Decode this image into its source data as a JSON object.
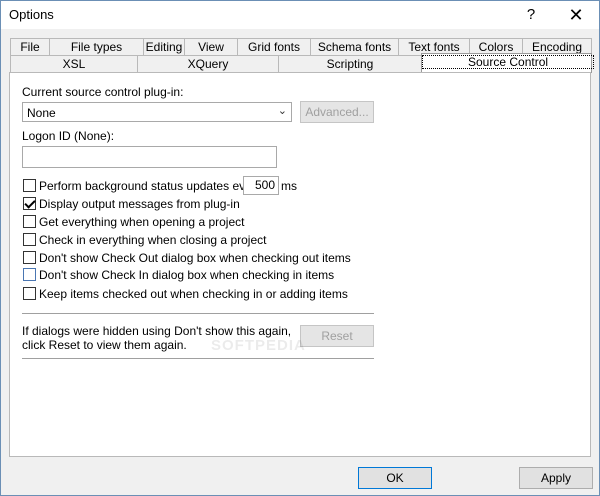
{
  "window": {
    "title": "Options",
    "help_glyph": "?",
    "close_glyph": "✕"
  },
  "tabs_row1": [
    "File",
    "File types",
    "Editing",
    "View",
    "Grid fonts",
    "Schema fonts",
    "Text fonts",
    "Colors",
    "Encoding"
  ],
  "tabs_row2": [
    "XSL",
    "XQuery",
    "Scripting",
    "Source Control"
  ],
  "active_tab": "Source Control",
  "source_control": {
    "plugin_label": "Current source control plug-in:",
    "plugin_value": "None",
    "advanced_button": "Advanced...",
    "logon_label": "Logon ID (None):",
    "logon_value": "",
    "bg_update_label": "Perform background status updates every",
    "bg_update_value": "500",
    "bg_update_unit": "ms",
    "options": [
      {
        "label": "Display output messages from plug-in",
        "checked": true
      },
      {
        "label": "Get everything when opening a project",
        "checked": false
      },
      {
        "label": "Check in everything when closing a project",
        "checked": false
      },
      {
        "label": "Don't show Check Out dialog box when checking out items",
        "checked": false
      },
      {
        "label": "Don't show Check In dialog box when checking in items",
        "checked": false
      },
      {
        "label": "Keep items checked out when checking in or adding items",
        "checked": false
      }
    ],
    "hidden_dialogs_line1": "If dialogs were hidden using Don't show this again,",
    "hidden_dialogs_line2": "click Reset to view them again.",
    "reset_button": "Reset"
  },
  "watermark": "SOFTPEDIA",
  "footer": {
    "ok_button": "OK",
    "apply_button": "Apply"
  }
}
